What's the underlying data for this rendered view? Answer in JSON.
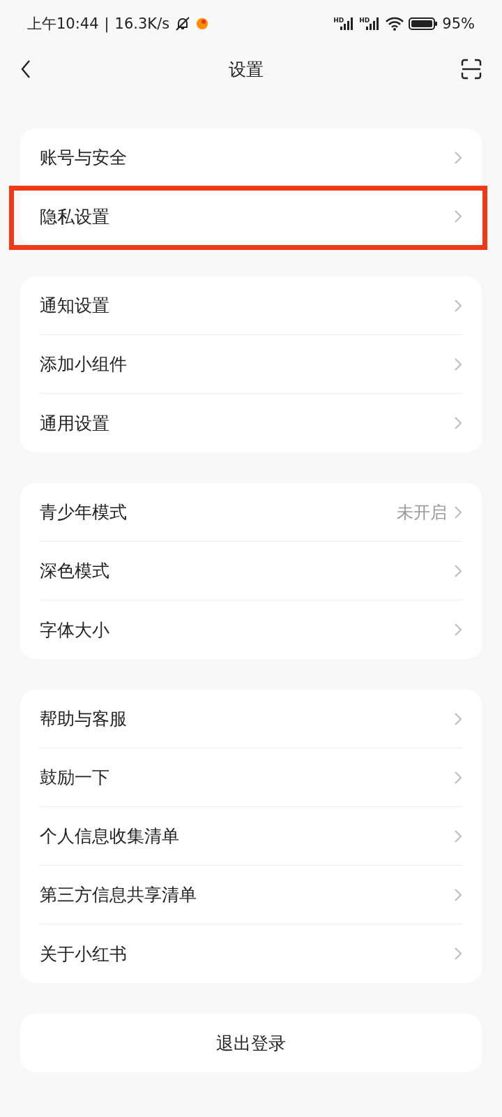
{
  "status_bar": {
    "time": "上午10:44",
    "separator": "|",
    "speed": "16.3K/s",
    "signal_labels": [
      "HD",
      "HD"
    ],
    "battery": "95%"
  },
  "header": {
    "title": "设置"
  },
  "groups": [
    {
      "items": [
        {
          "label": "账号与安全",
          "highlighted": false
        },
        {
          "label": "隐私设置",
          "highlighted": true
        }
      ]
    },
    {
      "items": [
        {
          "label": "通知设置",
          "highlighted": false
        },
        {
          "label": "添加小组件",
          "highlighted": false
        },
        {
          "label": "通用设置",
          "highlighted": false
        }
      ]
    },
    {
      "items": [
        {
          "label": "青少年模式",
          "value": "未开启",
          "highlighted": false
        },
        {
          "label": "深色模式",
          "highlighted": false
        },
        {
          "label": "字体大小",
          "highlighted": false
        }
      ]
    },
    {
      "items": [
        {
          "label": "帮助与客服",
          "highlighted": false
        },
        {
          "label": "鼓励一下",
          "highlighted": false
        },
        {
          "label": "个人信息收集清单",
          "highlighted": false
        },
        {
          "label": "第三方信息共享清单",
          "highlighted": false
        },
        {
          "label": "关于小红书",
          "highlighted": false
        }
      ]
    }
  ],
  "logout_button": "退出登录"
}
